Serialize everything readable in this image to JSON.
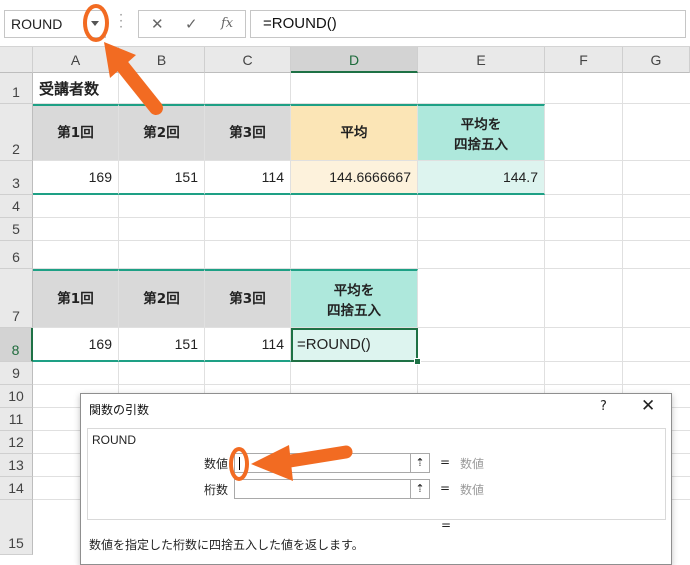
{
  "formula_bar": {
    "name_box": "ROUND",
    "cancel_icon": "✕",
    "enter_icon": "✓",
    "fx_icon": "fx",
    "formula": "=ROUND()"
  },
  "columns": [
    "A",
    "B",
    "C",
    "D",
    "E",
    "F",
    "G"
  ],
  "rows": [
    "1",
    "2",
    "3",
    "4",
    "5",
    "6",
    "7",
    "8",
    "9",
    "10",
    "11",
    "12",
    "13",
    "14",
    "15"
  ],
  "sheet": {
    "a1": "受講者数",
    "table1": {
      "h1": "第1回",
      "h2": "第2回",
      "h3": "第3回",
      "h4": "平均",
      "h5_line1": "平均を",
      "h5_line2": "四捨五入",
      "v1": "169",
      "v2": "151",
      "v3": "114",
      "v4": "144.6666667",
      "v5": "144.7"
    },
    "table2": {
      "h1": "第1回",
      "h2": "第2回",
      "h3": "第3回",
      "h4_line1": "平均を",
      "h4_line2": "四捨五入",
      "v1": "169",
      "v2": "151",
      "v3": "114",
      "v4": "=ROUND()"
    }
  },
  "dialog": {
    "title": "関数の引数",
    "help": "?",
    "close": "✕",
    "function_name": "ROUND",
    "arg1_label": "数値",
    "arg1_value": "",
    "arg1_result": "数値",
    "arg2_label": "桁数",
    "arg2_value": "",
    "arg2_result": "数値",
    "equals": "=",
    "description": "数値を指定した桁数に四捨五入した値を返します。"
  },
  "colors": {
    "accent_orange": "#f26b22",
    "header_gray": "#d9d9d9",
    "avg_yellow": "#fbe5b6",
    "round_teal": "#aee8dc",
    "excel_green": "#1e7145"
  }
}
